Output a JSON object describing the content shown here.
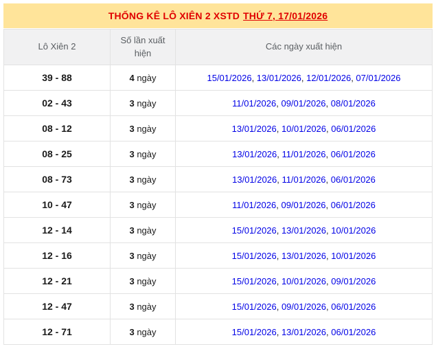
{
  "colors": {
    "title_bg": "#ffe49a",
    "title_text": "#e00000",
    "header_bg": "#f1f1f2",
    "header_text": "#5a5e62",
    "border": "#e2e2e2",
    "pair_text": "#1a1a1a",
    "date_link": "#0000e6"
  },
  "title": {
    "prefix": "THỐNG KÊ LÔ XIÊN 2 XSTD",
    "link": "THỨ 7, 17/01/2026"
  },
  "table": {
    "headers": [
      "Lô Xiên 2",
      "Số lần xuất hiện",
      "Các ngày xuất hiện"
    ],
    "unit": "ngày",
    "rows": [
      {
        "pair": "39 - 88",
        "count": "4",
        "dates": [
          "15/01/2026",
          "13/01/2026",
          "12/01/2026",
          "07/01/2026"
        ]
      },
      {
        "pair": "02 - 43",
        "count": "3",
        "dates": [
          "11/01/2026",
          "09/01/2026",
          "08/01/2026"
        ]
      },
      {
        "pair": "08 - 12",
        "count": "3",
        "dates": [
          "13/01/2026",
          "10/01/2026",
          "06/01/2026"
        ]
      },
      {
        "pair": "08 - 25",
        "count": "3",
        "dates": [
          "13/01/2026",
          "11/01/2026",
          "06/01/2026"
        ]
      },
      {
        "pair": "08 - 73",
        "count": "3",
        "dates": [
          "13/01/2026",
          "11/01/2026",
          "06/01/2026"
        ]
      },
      {
        "pair": "10 - 47",
        "count": "3",
        "dates": [
          "11/01/2026",
          "09/01/2026",
          "06/01/2026"
        ]
      },
      {
        "pair": "12 - 14",
        "count": "3",
        "dates": [
          "15/01/2026",
          "13/01/2026",
          "10/01/2026"
        ]
      },
      {
        "pair": "12 - 16",
        "count": "3",
        "dates": [
          "15/01/2026",
          "13/01/2026",
          "10/01/2026"
        ]
      },
      {
        "pair": "12 - 21",
        "count": "3",
        "dates": [
          "15/01/2026",
          "10/01/2026",
          "09/01/2026"
        ]
      },
      {
        "pair": "12 - 47",
        "count": "3",
        "dates": [
          "15/01/2026",
          "09/01/2026",
          "06/01/2026"
        ]
      },
      {
        "pair": "12 - 71",
        "count": "3",
        "dates": [
          "15/01/2026",
          "13/01/2026",
          "06/01/2026"
        ]
      }
    ]
  }
}
